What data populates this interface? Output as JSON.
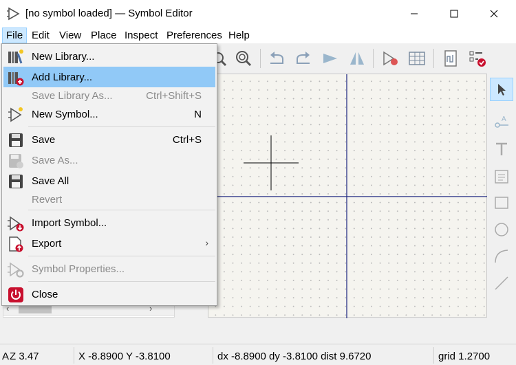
{
  "window": {
    "title": "[no symbol loaded] — Symbol Editor",
    "icon": "symbol-editor-icon"
  },
  "menubar": {
    "items": [
      "File",
      "Edit",
      "View",
      "Place",
      "Inspect",
      "Preferences",
      "Help"
    ],
    "active": "File"
  },
  "file_menu": {
    "items": [
      {
        "label": "New Library...",
        "shortcut": "",
        "icon": "new-library-icon",
        "enabled": true
      },
      {
        "label": "Add Library...",
        "shortcut": "",
        "icon": "add-library-icon",
        "enabled": true,
        "highlighted": true
      },
      {
        "label": "Save Library As...",
        "shortcut": "Ctrl+Shift+S",
        "icon": "",
        "enabled": false
      },
      {
        "label": "New Symbol...",
        "shortcut": "N",
        "icon": "new-symbol-icon",
        "enabled": true
      },
      {
        "label": "Save",
        "shortcut": "Ctrl+S",
        "icon": "save-icon",
        "enabled": true
      },
      {
        "label": "Save As...",
        "shortcut": "",
        "icon": "save-as-icon",
        "enabled": false
      },
      {
        "label": "Save All",
        "shortcut": "",
        "icon": "save-all-icon",
        "enabled": true
      },
      {
        "label": "Revert",
        "shortcut": "",
        "icon": "",
        "enabled": false
      },
      {
        "label": "Import Symbol...",
        "shortcut": "",
        "icon": "import-symbol-icon",
        "enabled": true
      },
      {
        "label": "Export",
        "shortcut": "",
        "icon": "export-icon",
        "enabled": true,
        "submenu": true
      },
      {
        "label": "Symbol Properties...",
        "shortcut": "",
        "icon": "symbol-properties-icon",
        "enabled": false
      },
      {
        "label": "Close",
        "shortcut": "",
        "icon": "close-power-icon",
        "enabled": true
      }
    ]
  },
  "status": {
    "zoom": "Z 3.47",
    "cursor": "X -8.8900  Y -3.8100",
    "delta": "dx -8.8900  dy -3.8100  dist 9.6720",
    "grid": "grid 1.2700",
    "prefix": "A"
  },
  "colors": {
    "menu_highlight": "#91c9f7",
    "axis": "#1a237e",
    "canvas_bg": "#f5f4ef"
  }
}
